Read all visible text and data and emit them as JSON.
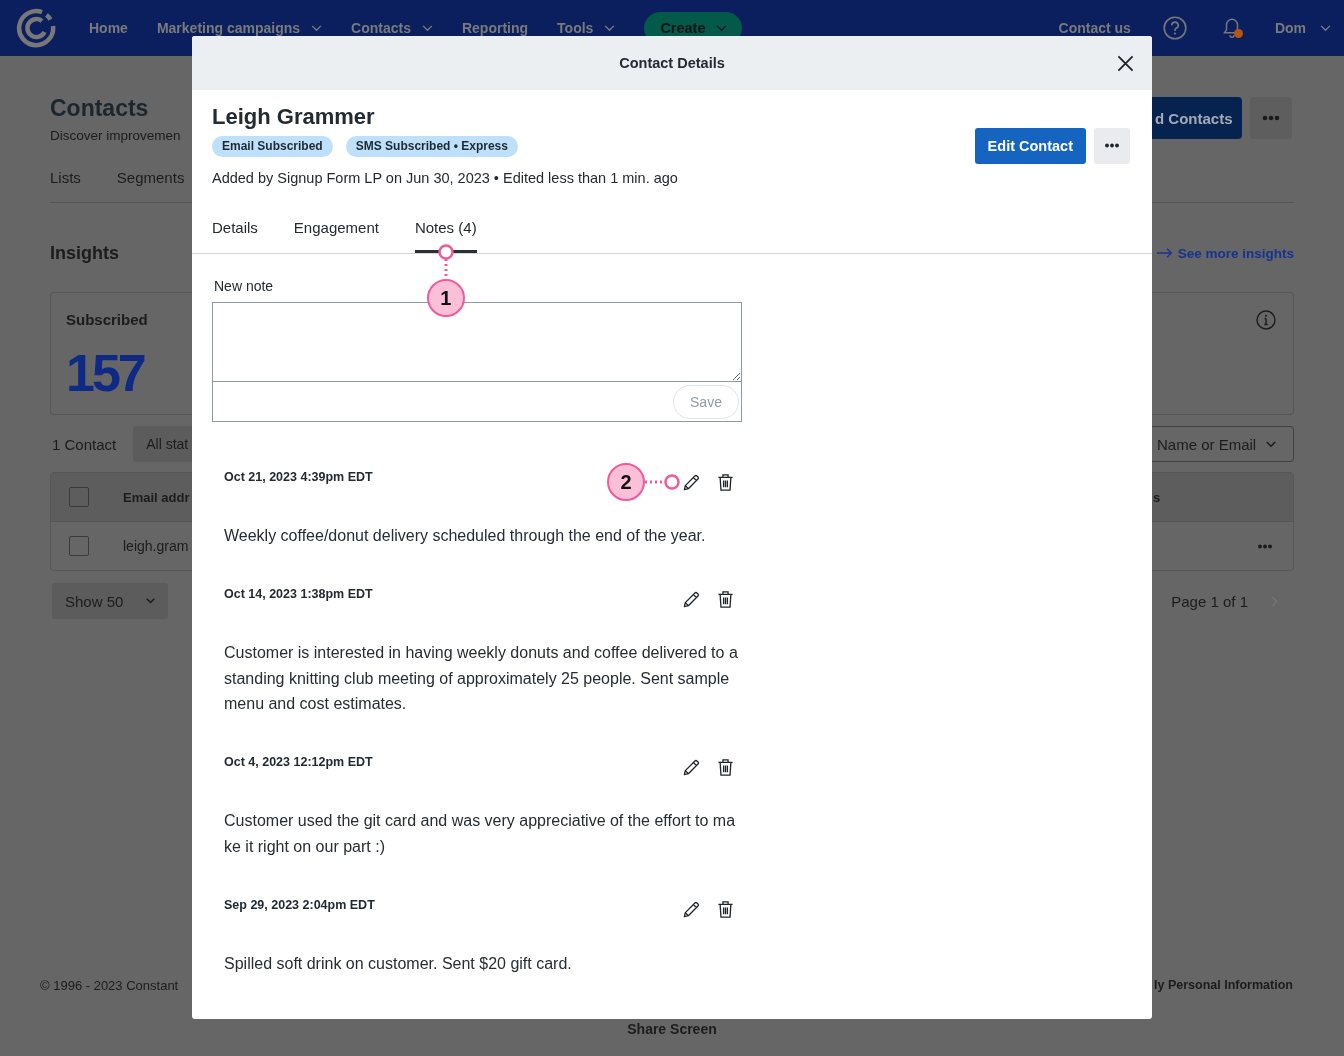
{
  "nav": {
    "items": [
      {
        "label": "Home",
        "dropdown": false
      },
      {
        "label": "Marketing campaigns",
        "dropdown": true
      },
      {
        "label": "Contacts",
        "dropdown": true
      },
      {
        "label": "Reporting",
        "dropdown": false
      },
      {
        "label": "Tools",
        "dropdown": true
      }
    ],
    "create_button": {
      "label": "Create",
      "dropdown": true
    },
    "contact_link": "Contact us",
    "notifications": true,
    "user": {
      "name": "Dom",
      "dropdown": true
    }
  },
  "page": {
    "title": "Contacts",
    "subtitle": "Discover improvemen",
    "tabs": [
      "Lists",
      "Segments"
    ],
    "add_button": "d Contacts",
    "insights": {
      "title": "Insights",
      "link": "See more insights",
      "card": {
        "label": "Subscribed",
        "value": "157"
      }
    },
    "contact_count": "1 Contact",
    "status_filter": "All stat",
    "sort_filter": "Name or Email",
    "table": {
      "select_all_checked": false,
      "columns": [
        "Email addr",
        "s"
      ],
      "rows": [
        {
          "checked": false,
          "email": "leigh.gram"
        }
      ]
    },
    "page_size": "Show 50",
    "pagination": "Page 1 of 1",
    "next_disabled": true
  },
  "modal": {
    "title": "Contact Details",
    "contact": {
      "name": "Leigh Grammer",
      "badges": [
        "Email Subscribed",
        "SMS Subscribed • Express"
      ],
      "meta": "Added by Signup Form LP on Jun 30, 2023 • Edited less than 1 min. ago"
    },
    "edit_button": "Edit Contact",
    "tabs": [
      {
        "label": "Details",
        "selected": false
      },
      {
        "label": "Engagement",
        "selected": false
      },
      {
        "label": "Notes (4)",
        "selected": true,
        "callout": "1"
      }
    ],
    "new_note": {
      "label": "New note",
      "save_button": {
        "label": "Save",
        "disabled": true
      }
    },
    "notes": [
      {
        "date": "Oct 21, 2023 4:39pm EDT",
        "text": "Weekly coffee/donut delivery scheduled through the end of the year.",
        "callout": "2"
      },
      {
        "date": "Oct 14, 2023 1:38pm EDT",
        "text": "Customer is interested in having weekly donuts and coffee delivered to a standing knitting club meeting of approximately 25 people. Sent sample menu and cost estimates."
      },
      {
        "date": "Oct 4, 2023 12:12pm EDT",
        "text": "Customer used the git card and was very appreciative of the effort to make it right on our part :)"
      },
      {
        "date": "Sep 29, 2023 2:04pm EDT",
        "text": "Spilled soft drink on customer. Sent $20 gift card."
      }
    ]
  },
  "footer": {
    "copyright": "© 1996 - 2023 Constant",
    "privacy_link": "ly Personal Information",
    "share_link": "Share Screen"
  }
}
